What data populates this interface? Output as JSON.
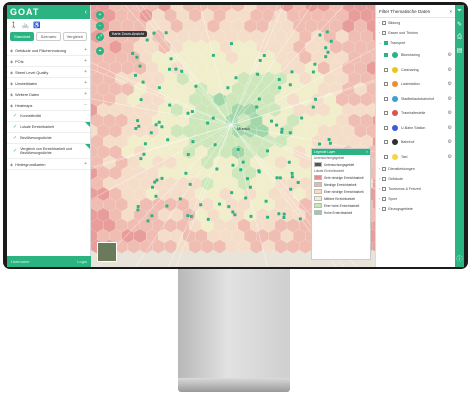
{
  "app": {
    "logo": "GOAT"
  },
  "left_panel": {
    "tabs": [
      "Standard",
      "Szenario",
      "Vergleich"
    ],
    "layers": [
      {
        "label": "Gebäude und Flächennutzung"
      },
      {
        "label": "POIs"
      },
      {
        "label": "Street Level Quality"
      },
      {
        "label": "Umweltdaten"
      },
      {
        "label": "Weitere Daten"
      },
      {
        "label": "Heatmaps"
      }
    ],
    "heatmaps": [
      {
        "label": "Konnektivität"
      },
      {
        "label": "Lokale Erreichbarkeit"
      },
      {
        "label": "Bevölkerungsdichte"
      },
      {
        "label": "Vergleich von Erreichbarkeit und Bevölkerungsdichte"
      }
    ],
    "bottom_layer": "Hintergrundkarten",
    "footer": {
      "left": "Username",
      "right": "Login"
    }
  },
  "map": {
    "tooltip": "Karte Zoom-Ansicht",
    "city_label": "Munich",
    "legend": {
      "title": "Legende Layer",
      "section1": "Untersuchungsgebiet",
      "item1": "Untersuchungsgebiet",
      "section2": "Lokale Erreichbarkeit",
      "classes": [
        {
          "label": "Sehr niedrige Erreichbarkeit",
          "color": "#e78b8b"
        },
        {
          "label": "Niedrige Erreichbarkeit",
          "color": "#f1b3a7"
        },
        {
          "label": "Eher niedrige Erreichbarkeit",
          "color": "#f7dcc4"
        },
        {
          "label": "Mittlere Erreichbarkeit",
          "color": "#f3f0c8"
        },
        {
          "label": "Eher hohe Erreichbarkeit",
          "color": "#c6e7b3"
        },
        {
          "label": "Hohe Erreichbarkeit",
          "color": "#8fd39c"
        }
      ]
    }
  },
  "right_panel": {
    "title": "Filter Thematische Daten",
    "categories_top": [
      "Bildung",
      "Essen und Trinken",
      "Transport"
    ],
    "poi_items": [
      {
        "label": "Bikesharing",
        "checked": true,
        "color": "#2bb381"
      },
      {
        "label": "Carsharing",
        "checked": false,
        "color": "#f0c419"
      },
      {
        "label": "Ladestation",
        "checked": false,
        "color": "#f28c28"
      },
      {
        "label": "Stadtteilautobahnhof",
        "checked": false,
        "color": "#3aa0d8"
      },
      {
        "label": "Tramhaltestelle",
        "checked": false,
        "color": "#d9534f"
      },
      {
        "label": "U-Bahn Station",
        "checked": false,
        "color": "#3b5bdb"
      },
      {
        "label": "Bahnhof",
        "checked": false,
        "color": "#2f2f2f"
      },
      {
        "label": "Taxi",
        "checked": false,
        "color": "#f5d547"
      }
    ],
    "categories_bottom": [
      "Dienstleistungen",
      "Gebäude",
      "Tourismus & Freizeit",
      "Sport",
      "Einzugsgebiete"
    ]
  }
}
